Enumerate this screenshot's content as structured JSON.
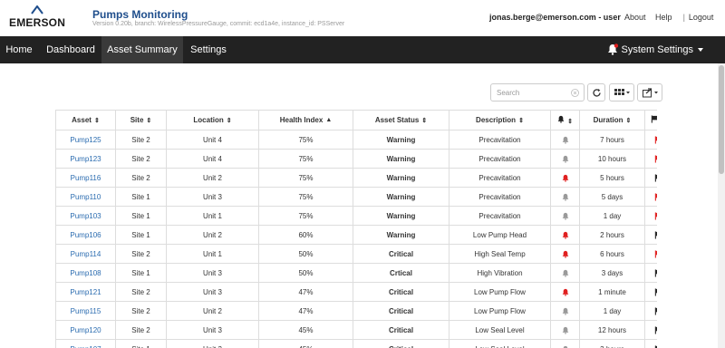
{
  "header": {
    "logo_text": "EMERSON",
    "app_title": "Pumps Monitoring",
    "subtitle": "Version 0.20b, branch: WirelessPressureGauge, commit: ecd1a4e, instance_id: PSServer",
    "user": "jonas.berge@emerson.com - user",
    "links": {
      "about": "About",
      "help": "Help",
      "sep": "|",
      "logout": "Logout"
    }
  },
  "nav": {
    "items": [
      "Home",
      "Dashboard",
      "Asset Summary",
      "Settings"
    ],
    "active": "Asset Summary",
    "right_label": "System Settings"
  },
  "toolbar": {
    "search_placeholder": "Search"
  },
  "table": {
    "columns": [
      "Asset",
      "Site",
      "Location",
      "Health Index",
      "Asset Status",
      "Description",
      "",
      "Duration",
      ""
    ],
    "rows": [
      {
        "asset": "Pump125",
        "site": "Site 2",
        "location": "Unit 4",
        "health": "75%",
        "status": "Warning",
        "description": "Precavitation",
        "bell": "grey",
        "duration": "7 hours",
        "flag": "red"
      },
      {
        "asset": "Pump123",
        "site": "Site 2",
        "location": "Unit 4",
        "health": "75%",
        "status": "Warning",
        "description": "Precavitation",
        "bell": "grey",
        "duration": "10 hours",
        "flag": "red"
      },
      {
        "asset": "Pump116",
        "site": "Site 2",
        "location": "Unit 2",
        "health": "75%",
        "status": "Warning",
        "description": "Precavitation",
        "bell": "red",
        "duration": "5 hours",
        "flag": "black"
      },
      {
        "asset": "Pump110",
        "site": "Site 1",
        "location": "Unit 3",
        "health": "75%",
        "status": "Warning",
        "description": "Precavitation",
        "bell": "grey",
        "duration": "5 days",
        "flag": "red"
      },
      {
        "asset": "Pump103",
        "site": "Site 1",
        "location": "Unit 1",
        "health": "75%",
        "status": "Warning",
        "description": "Precavitation",
        "bell": "grey",
        "duration": "1 day",
        "flag": "red"
      },
      {
        "asset": "Pump106",
        "site": "Site 1",
        "location": "Unit 2",
        "health": "60%",
        "status": "Warning",
        "description": "Low Pump Head",
        "bell": "red",
        "duration": "2 hours",
        "flag": "black"
      },
      {
        "asset": "Pump114",
        "site": "Site 2",
        "location": "Unit 1",
        "health": "50%",
        "status": "Critical",
        "description": "High Seal Temp",
        "bell": "red",
        "duration": "6 hours",
        "flag": "red"
      },
      {
        "asset": "Pump108",
        "site": "Site 1",
        "location": "Unit 3",
        "health": "50%",
        "status": "Crtical",
        "description": "High Vibration",
        "bell": "grey",
        "duration": "3 days",
        "flag": "black"
      },
      {
        "asset": "Pump121",
        "site": "Site 2",
        "location": "Unit 3",
        "health": "47%",
        "status": "Critical",
        "description": "Low Pump Flow",
        "bell": "red",
        "duration": "1 minute",
        "flag": "black"
      },
      {
        "asset": "Pump115",
        "site": "Site 2",
        "location": "Unit 2",
        "health": "47%",
        "status": "Critical",
        "description": "Low Pump Flow",
        "bell": "grey",
        "duration": "1 day",
        "flag": "black"
      },
      {
        "asset": "Pump120",
        "site": "Site 2",
        "location": "Unit 3",
        "health": "45%",
        "status": "Critical",
        "description": "Low Seal Level",
        "bell": "grey",
        "duration": "12 hours",
        "flag": "black"
      },
      {
        "asset": "Pump107",
        "site": "Site 1",
        "location": "Unit 3",
        "health": "45%",
        "status": "Critical",
        "description": "Low Seal Level",
        "bell": "grey",
        "duration": "3 hours",
        "flag": "black"
      }
    ]
  },
  "colors": {
    "nav_bg": "#222222",
    "active_tab": "#3a3a3a",
    "title_blue": "#1f4e8c",
    "link_blue": "#2b6cb0",
    "alert_red": "#e02020",
    "muted_grey": "#9a9a9a"
  },
  "icons": {
    "bell": "bell-icon",
    "flag": "flag-icon",
    "refresh": "refresh-icon",
    "columns": "columns-icon",
    "export": "export-icon",
    "clear": "clear-icon"
  }
}
